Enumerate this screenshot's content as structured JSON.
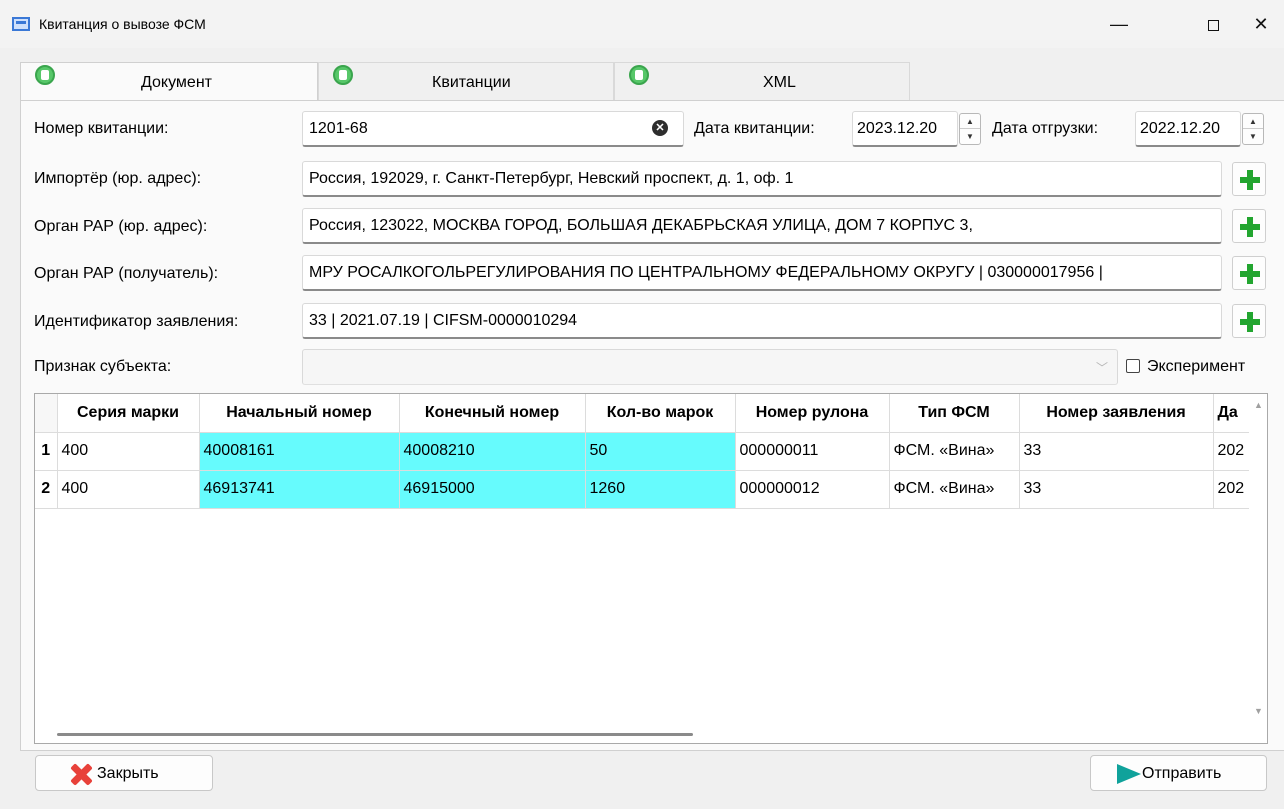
{
  "window": {
    "title": "Квитанция о вывозе ФСМ",
    "minimize_glyph": "—",
    "close_glyph": "✕"
  },
  "tabs": [
    {
      "label": "Документ",
      "active": true
    },
    {
      "label": "Квитанции",
      "active": false
    },
    {
      "label": "XML",
      "active": false
    }
  ],
  "form": {
    "receipt_number_label": "Номер квитанции:",
    "receipt_number_value": "1201-68",
    "receipt_date_label": "Дата квитанции:",
    "receipt_date_value": "2023.12.20",
    "shipment_date_label": "Дата отгрузки:",
    "shipment_date_value": "2022.12.20",
    "importer_label": "Импортёр (юр. адрес):",
    "importer_value": "Россия, 192029, г. Санкт-Петербург, Невский проспект, д. 1, оф. 1",
    "rar_address_label": "Орган РАР (юр. адрес):",
    "rar_address_value": "Россия, 123022, МОСКВА ГОРОД, БОЛЬШАЯ ДЕКАБРЬСКАЯ УЛИЦА, ДОМ 7 КОРПУС 3,",
    "rar_recipient_label": "Орган РАР (получатель):",
    "rar_recipient_value": "МРУ РОСАЛКОГОЛЬРЕГУЛИРОВАНИЯ ПО ЦЕНТРАЛЬНОМУ ФЕДЕРАЛЬНОМУ ОКРУГУ | 030000017956 |",
    "application_id_label": "Идентификатор заявления:",
    "application_id_value": "33 | 2021.07.19 | CIFSM-0000010294",
    "subject_sign_label": "Признак субъекта:",
    "subject_sign_value": "",
    "experiment_label": "Эксперимент",
    "experiment_checked": false
  },
  "table": {
    "columns": [
      "Серия марки",
      "Начальный номер",
      "Конечный номер",
      "Кол-во марок",
      "Номер рулона",
      "Тип ФСМ",
      "Номер заявления",
      "Да"
    ],
    "rows": [
      {
        "num": "1",
        "cells": [
          "400",
          "40008161",
          "40008210",
          "50",
          "000000011",
          "ФСМ. «Вина»",
          "33",
          "202"
        ]
      },
      {
        "num": "2",
        "cells": [
          "400",
          "46913741",
          "46915000",
          "1260",
          "000000012",
          "ФСМ. «Вина»",
          "33",
          "202"
        ]
      }
    ],
    "highlight_color": "#66fbfd"
  },
  "buttons": {
    "close_label": "Закрыть",
    "send_label": "Отправить"
  }
}
